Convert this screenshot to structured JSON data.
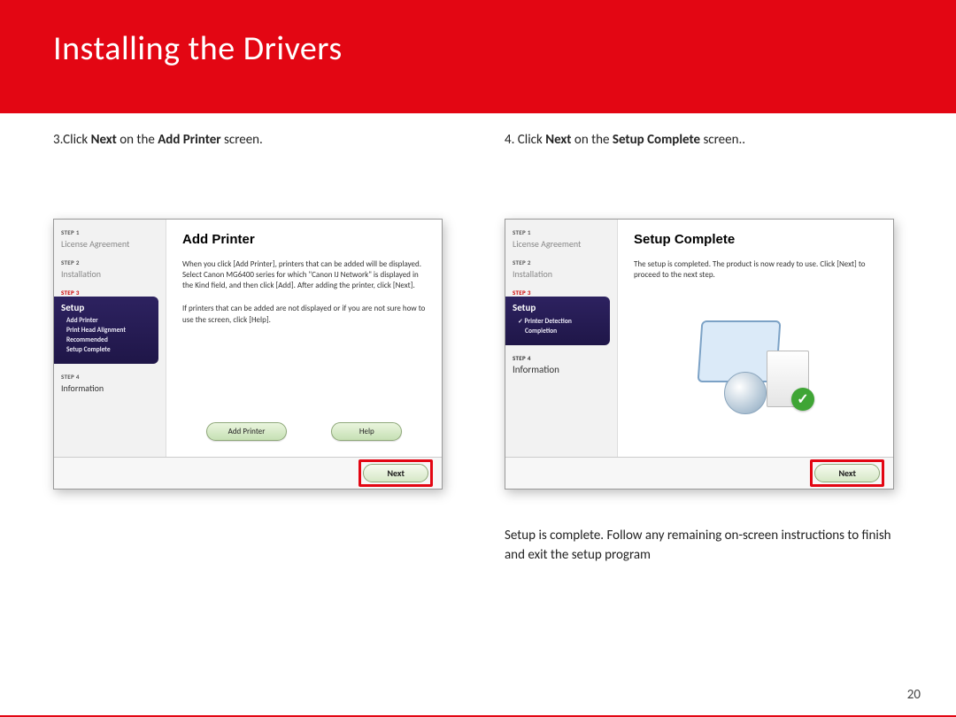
{
  "slide": {
    "title": "Installing  the Drivers",
    "page_number": "20"
  },
  "left": {
    "instruction_num": "3.",
    "instruction_pre": "Click ",
    "instruction_b1": "Next",
    "instruction_mid": " on the ",
    "instruction_b2": "Add Printer",
    "instruction_post": " screen.",
    "dialog": {
      "sidebar": {
        "step1_lbl": "STEP 1",
        "step1_name": "License Agreement",
        "step2_lbl": "STEP 2",
        "step2_name": "Installation",
        "step3_lbl": "STEP 3",
        "setup_title": "Setup",
        "sub1": "Add Printer",
        "sub2": "Print Head Alignment",
        "sub3": "Recommended",
        "sub4": "Setup Complete",
        "step4_lbl": "STEP 4",
        "step4_name": "Information"
      },
      "panel": {
        "heading": "Add Printer",
        "para1": "When you click [Add Printer], printers that can be added will be displayed. Select Canon MG6400 series for which \"Canon IJ Network\" is displayed in the Kind field, and then click [Add]. After adding the printer, click [Next].",
        "para2": "If printers that can be added are not displayed or if you are not sure how to use the screen, click [Help].",
        "btn_add": "Add Printer",
        "btn_help": "Help"
      },
      "next_label": "Next"
    }
  },
  "right": {
    "instruction_num": "4. ",
    "instruction_pre": "Click ",
    "instruction_b1": "Next",
    "instruction_mid": " on the ",
    "instruction_b2": "Setup Complete",
    "instruction_post": " screen..",
    "dialog": {
      "sidebar": {
        "step1_lbl": "STEP 1",
        "step1_name": "License Agreement",
        "step2_lbl": "STEP 2",
        "step2_name": "Installation",
        "step3_lbl": "STEP 3",
        "setup_title": "Setup",
        "sub1": "Printer Detection",
        "sub2": "Completion",
        "step4_lbl": "STEP 4",
        "step4_name": "Information"
      },
      "panel": {
        "heading": "Setup Complete",
        "para1": "The setup is completed. The product is now ready to use. Click [Next] to proceed to the next step."
      },
      "next_label": "Next"
    },
    "footnote": "Setup is complete.  Follow any remaining on-screen instructions to finish and exit the setup program"
  }
}
